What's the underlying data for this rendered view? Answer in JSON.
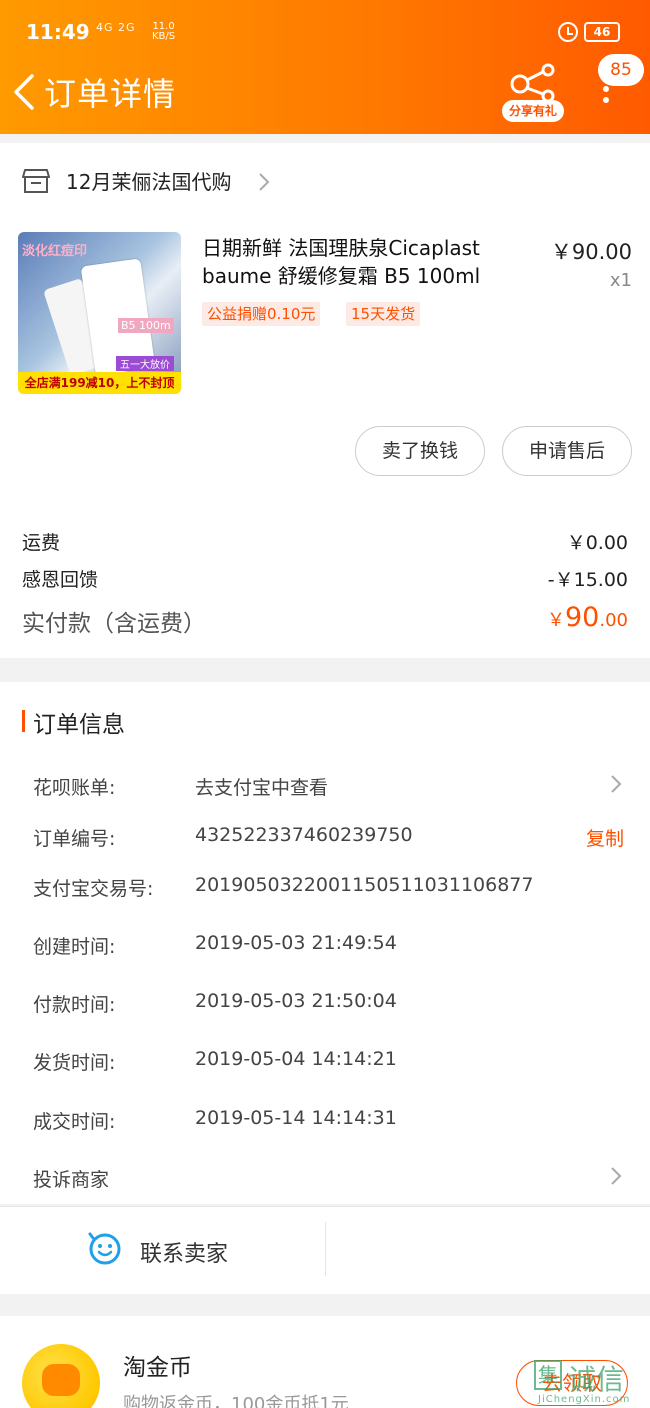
{
  "status_bar": {
    "time": "11:49",
    "signal": "4G 2G",
    "speed_value": "11.0",
    "speed_unit": "KB/S",
    "battery": "46"
  },
  "header": {
    "back_icon": "chevron-left-icon",
    "title": "订单详情",
    "share_label": "分享有礼",
    "badge": "85",
    "more_icon": "more-vertical-icon",
    "accent": "#ff5000"
  },
  "store": {
    "name": "12月茉俪法国代购",
    "icon": "store-icon"
  },
  "product": {
    "image_texts": {
      "top": "淡化红痘印",
      "label": "B5 100m",
      "tag": "五一大放价",
      "bottom": "全店满199减10，上不封顶"
    },
    "title": "日期新鲜 法国理肤泉Cicaplast baume 舒缓修复霜 B5 100ml",
    "tag_charity": "公益捐赠0.10元",
    "tag_ship": "15天发货",
    "price": "￥90.00",
    "qty": "x1"
  },
  "buttons": {
    "sell": "卖了换钱",
    "service": "申请售后"
  },
  "fees": {
    "shipping_label": "运费",
    "shipping_value": "￥0.00",
    "thanks_label": "感恩回馈",
    "thanks_value": "-￥15.00",
    "total_label": "实付款（含运费）",
    "total_symbol": "￥",
    "total_int": "90",
    "total_dec": ".00"
  },
  "order_info": {
    "title": "订单信息",
    "huabei_label": "花呗账单:",
    "huabei_value": "去支付宝中查看",
    "order_no_label": "订单编号:",
    "order_no_value": "432522337460239750",
    "copy_label": "复制",
    "alipay_label": "支付宝交易号:",
    "alipay_value": "2019050322001150511031106877",
    "created_label": "创建时间:",
    "created_value": "2019-05-03 21:49:54",
    "paid_label": "付款时间:",
    "paid_value": "2019-05-03 21:50:04",
    "shipped_label": "发货时间:",
    "shipped_value": "2019-05-04 14:14:21",
    "completed_label": "成交时间:",
    "completed_value": "2019-05-14 14:14:31",
    "complaint_label": "投诉商家"
  },
  "actions": {
    "contact_label": "联系卖家",
    "contact_icon": "chat-smile-icon"
  },
  "coin": {
    "title": "淘金币",
    "subtitle": "购物返金币，100金币抵1元",
    "claim_label": "去领取"
  },
  "watermark": {
    "mark": "集",
    "text": "诚信",
    "small": "JiChengXin.com"
  }
}
